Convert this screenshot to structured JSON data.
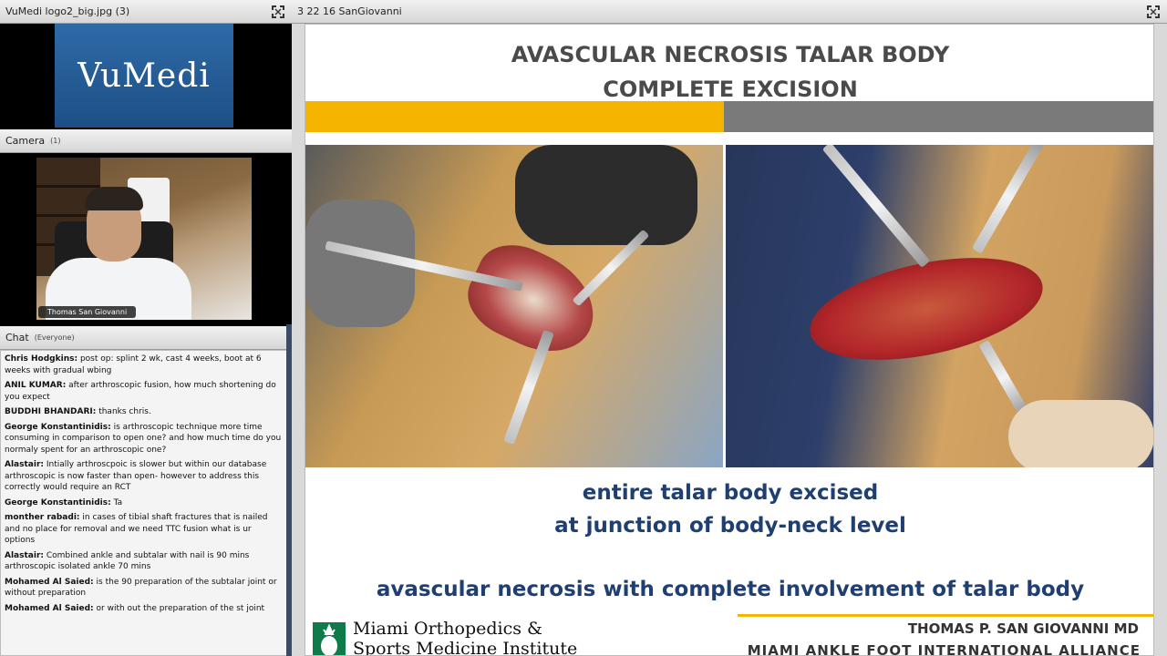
{
  "logo_pod": {
    "title": "VuMedi logo2_big.jpg (3)",
    "logo_text": "VuMedi"
  },
  "camera_pod": {
    "title": "Camera",
    "count": "(1)",
    "name_tag": "Thomas San Giovanni"
  },
  "chat_pod": {
    "title": "Chat",
    "audience": "(Everyone)",
    "messages": [
      {
        "sender": "Chris Hodgkins:",
        "text": "post op: splint 2 wk, cast 4 weeks, boot at 6 weeks with gradual wbing"
      },
      {
        "sender": "ANIL KUMAR:",
        "text": "after arthroscopic fusion, how much shortening do you expect"
      },
      {
        "sender": "BUDDHI BHANDARI:",
        "text": "thanks chris."
      },
      {
        "sender": "George Konstantinidis:",
        "text": "is arthroscopic technique more time consuming in comparison to open one?  and how much time do you normaly spent for an arthroscopic one?"
      },
      {
        "sender": "Alastair:",
        "text": "Intially arthroscpoic is slower but within our database arthroscopic is now faster than open- however to address this correctly would require an RCT"
      },
      {
        "sender": "George Konstantinidis:",
        "text": "Ta"
      },
      {
        "sender": "monther rabadi:",
        "text": "in cases of tibial shaft fractures that is nailed and no place for removal and we need TTC fusion what is ur options"
      },
      {
        "sender": "Alastair:",
        "text": "Combined ankle and subtalar with nail is 90 mins arthroscopic isolated ankle 70 mins"
      },
      {
        "sender": "Mohamed Al Saied:",
        "text": "is the 90 preparation of the subtalar joint or without preparation"
      },
      {
        "sender": "Mohamed Al Saied:",
        "text": "or with out the preparation of the st joint"
      }
    ]
  },
  "share_pod": {
    "title": "3 22 16 SanGiovanni",
    "slide": {
      "title_line1": "AVASCULAR NECROSIS TALAR BODY",
      "title_line2": "COMPLETE EXCISION",
      "caption_line1": "entire talar body excised",
      "caption_line2": "at junction of body-neck level",
      "caption_line3": "avascular necrosis with complete involvement of talar body",
      "footer_org_line1": "Miami Orthopedics &",
      "footer_org_line2": "Sports Medicine Institute",
      "footer_name": "THOMAS P. SAN GIOVANNI MD",
      "footer_alliance": "MIAMI ANKLE FOOT INTERNATIONAL ALLIANCE"
    }
  },
  "colors": {
    "accent_yellow": "#f4b400",
    "caption_blue": "#1f3f72",
    "logo_blue": "#2f6aa7"
  }
}
